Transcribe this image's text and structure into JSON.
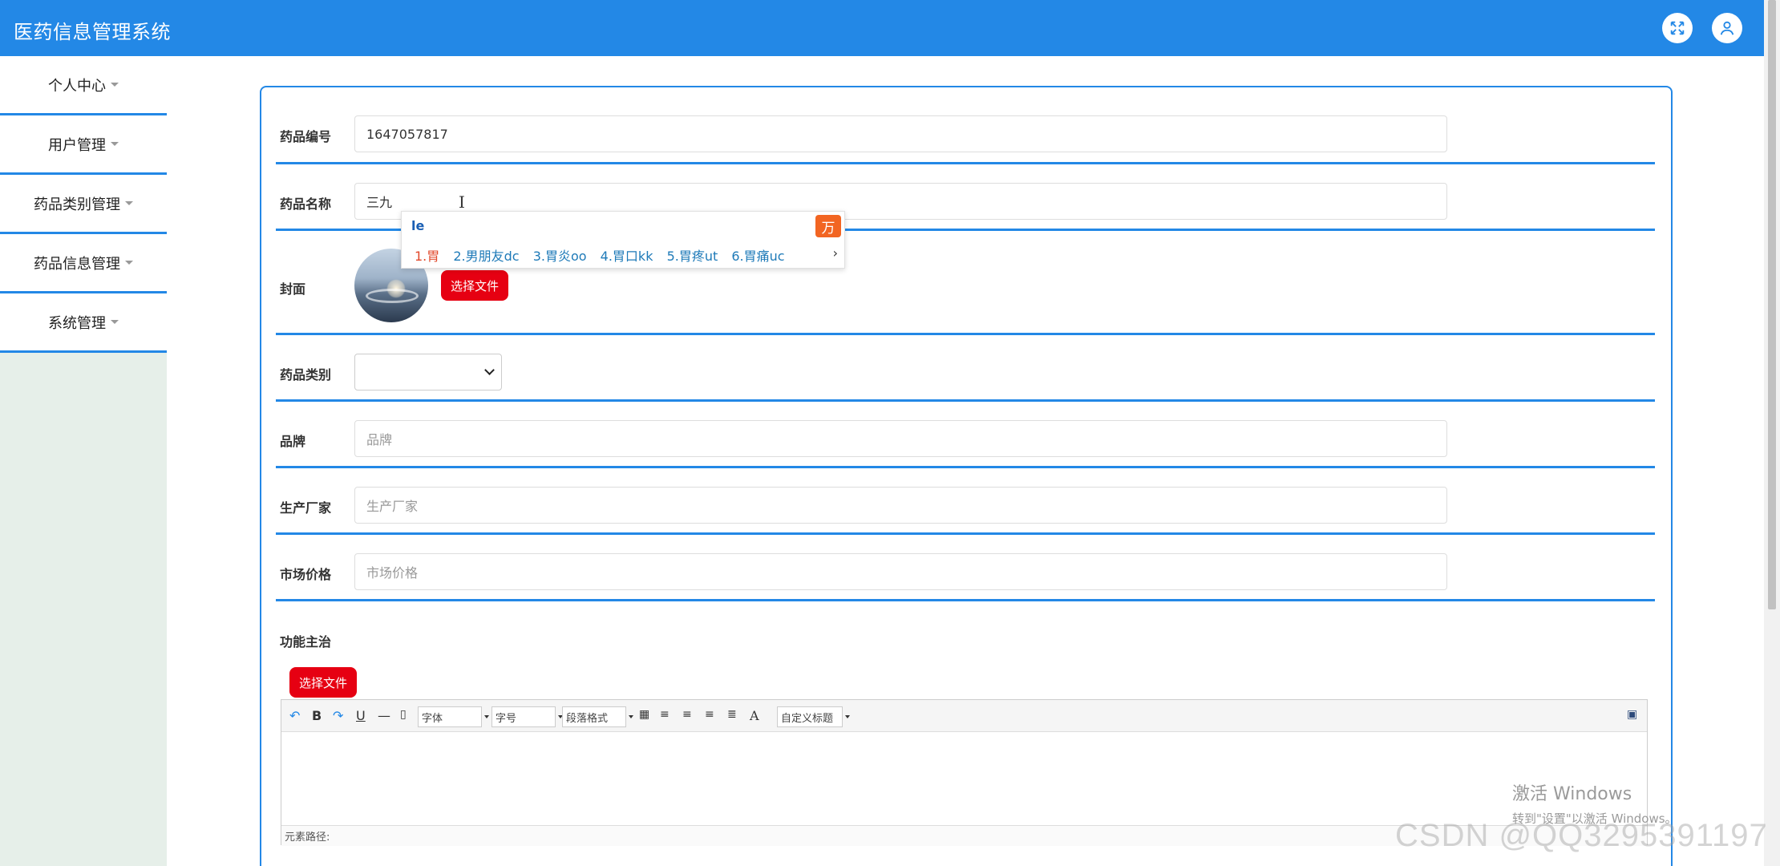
{
  "header": {
    "title": "医药信息管理系统"
  },
  "sidebar": {
    "items": [
      {
        "label": "个人中心"
      },
      {
        "label": "用户管理"
      },
      {
        "label": "药品类别管理"
      },
      {
        "label": "药品信息管理"
      },
      {
        "label": "系统管理"
      }
    ]
  },
  "form": {
    "drug_no": {
      "label": "药品编号",
      "value": "1647057817"
    },
    "drug_name": {
      "label": "药品名称",
      "value": "三九"
    },
    "cover": {
      "label": "封面",
      "button": "选择文件"
    },
    "category": {
      "label": "药品类别",
      "value": ""
    },
    "brand": {
      "label": "品牌",
      "placeholder": "品牌"
    },
    "manufacturer": {
      "label": "生产厂家",
      "placeholder": "生产厂家"
    },
    "price": {
      "label": "市场价格",
      "placeholder": "市场价格"
    },
    "indications": {
      "label": "功能主治",
      "button": "选择文件"
    }
  },
  "ime": {
    "input": "le",
    "logo": "万",
    "candidates": [
      "1.胃",
      "2.男朋友dc",
      "3.胃炎oo",
      "4.胃口kk",
      "5.胃疼ut",
      "6.胃痛uc"
    ]
  },
  "editor": {
    "font_label": "字体",
    "size_label": "字号",
    "para_label": "段落格式",
    "custom_title_label": "自定义标题",
    "status": "元素路径:"
  },
  "watermark": {
    "activate_title": "激活 Windows",
    "activate_sub": "转到\"设置\"以激活 Windows。",
    "csdn": "CSDN @QQ3295391197"
  },
  "colors": {
    "primary": "#2388e6",
    "danger": "#e60012",
    "sidebar_bg": "#e6efe9"
  },
  "icons": {
    "fullscreen": "fullscreen-icon",
    "user": "user-icon"
  }
}
